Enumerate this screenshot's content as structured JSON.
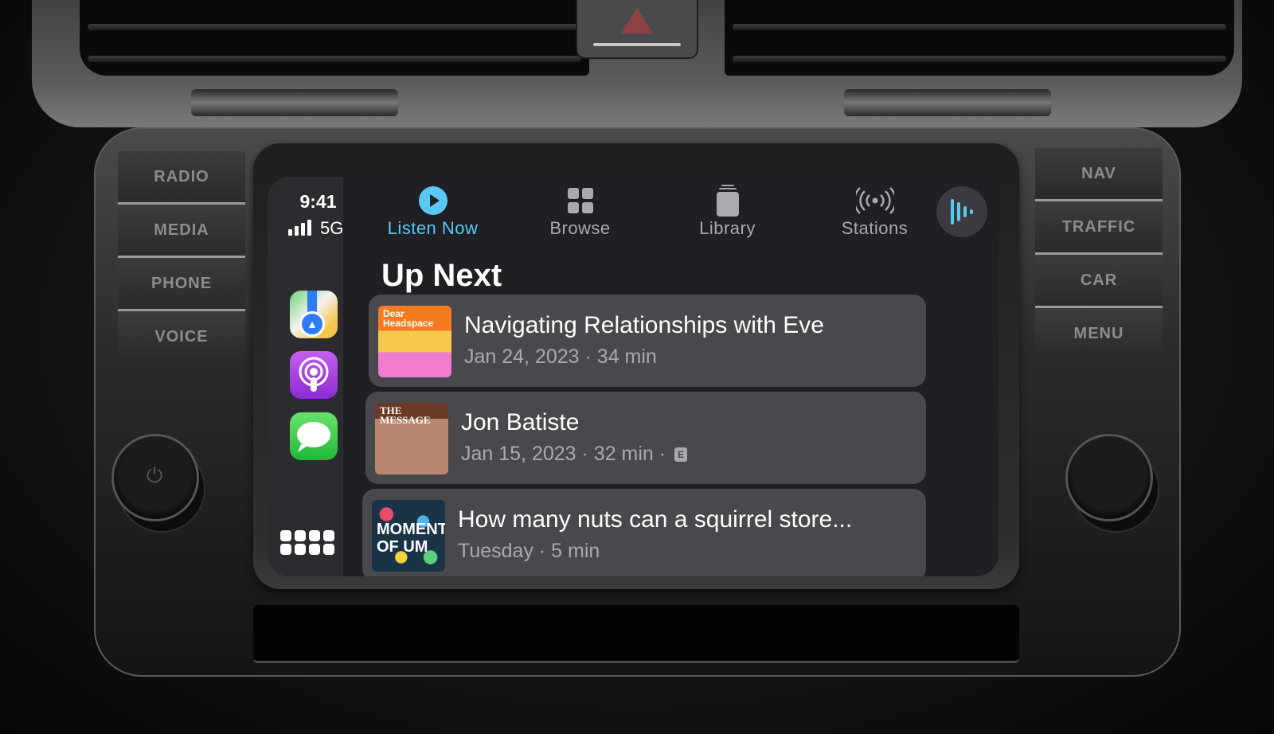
{
  "dashboard": {
    "left_buttons": [
      "RADIO",
      "MEDIA",
      "PHONE",
      "VOICE"
    ],
    "right_buttons": [
      "NAV",
      "TRAFFIC",
      "CAR",
      "MENU"
    ]
  },
  "status": {
    "time": "9:41",
    "network": "5G",
    "signal_bars": 4
  },
  "sidebar": {
    "apps": [
      {
        "name": "Maps",
        "icon": "maps-icon"
      },
      {
        "name": "Podcasts",
        "icon": "podcasts-icon"
      },
      {
        "name": "Messages",
        "icon": "messages-icon"
      }
    ],
    "app_grid_icon": "app-grid-icon"
  },
  "tabs": [
    {
      "label": "Listen Now",
      "icon": "play-circle-icon",
      "active": true
    },
    {
      "label": "Browse",
      "icon": "grid-icon",
      "active": false
    },
    {
      "label": "Library",
      "icon": "library-stack-icon",
      "active": false
    },
    {
      "label": "Stations",
      "icon": "broadcast-icon",
      "active": false
    }
  ],
  "accent_color": "#5ac8f5",
  "now_playing_icon": "waveform-icon",
  "section_title": "Up Next",
  "episodes": [
    {
      "artwork_text": "Dear Headspace",
      "title": "Navigating Relationships with Eve",
      "meta": "Jan 24, 2023 · 34 min",
      "explicit": false
    },
    {
      "artwork_text": "THE MESSAGE",
      "title": "Jon Batiste",
      "meta": "Jan 15, 2023 · 32 min ·",
      "explicit": true,
      "explicit_label": "E"
    },
    {
      "artwork_text": "MOMENT OF UM",
      "title": "How many nuts can a squirrel store...",
      "meta": "Tuesday · 5 min",
      "explicit": false
    }
  ]
}
